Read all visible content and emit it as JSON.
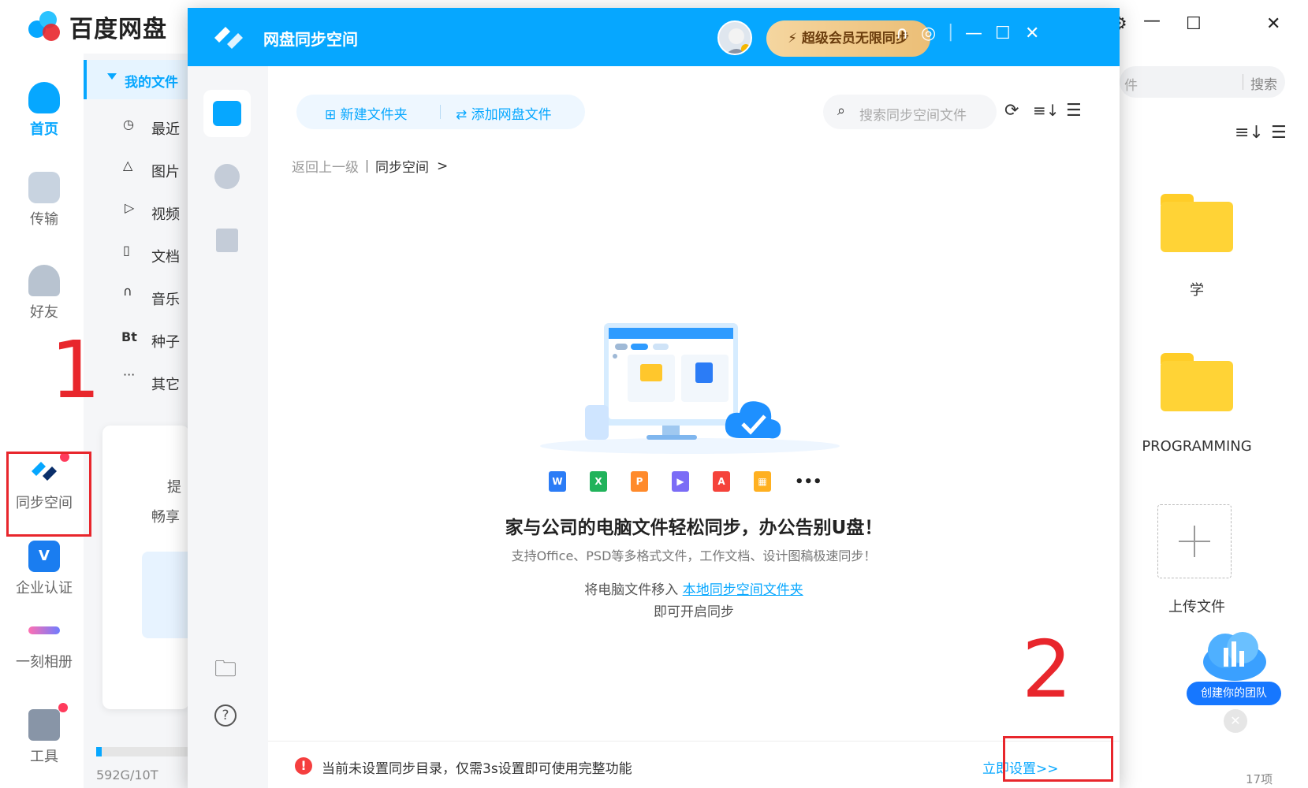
{
  "main_app": {
    "logo_text": "百度网盘",
    "rail": [
      {
        "label": "首页",
        "icon": "cloud-icon"
      },
      {
        "label": "传输",
        "icon": "transfer-icon"
      },
      {
        "label": "好友",
        "icon": "friends-icon"
      },
      {
        "label": "同步空间",
        "icon": "sync-space-icon"
      },
      {
        "label": "企业认证",
        "icon": "enterprise-icon"
      },
      {
        "label": "一刻相册",
        "icon": "album-icon"
      },
      {
        "label": "工具",
        "icon": "tools-icon"
      }
    ],
    "nav": {
      "my_files": "我的文件",
      "items": [
        "最近",
        "图片",
        "视频",
        "文档",
        "音乐",
        "种子",
        "其它"
      ],
      "bt_glyph": "Bt"
    },
    "promo": {
      "line1": "提",
      "line2": "畅享"
    },
    "storage": {
      "text": "592G/10T",
      "used_fraction": 0.058
    },
    "right": {
      "search_placeholder": "件",
      "search_button": "搜索",
      "folders": [
        "学",
        "PROGRAMMING"
      ],
      "upload_label": "上传文件",
      "team_badge": "创建你的团队",
      "count": "17项"
    }
  },
  "annotations": {
    "step1": "1",
    "step2": "2"
  },
  "sync_window": {
    "title": "网盘同步空间",
    "vip_button": "超级会员无限同步",
    "actions": {
      "new_folder": "新建文件夹",
      "add_files": "添加网盘文件"
    },
    "search_placeholder": "搜索同步空间文件",
    "breadcrumb": {
      "back": "返回上一级",
      "current": "同步空间",
      "arrow": ">"
    },
    "file_types": [
      {
        "glyph": "W",
        "color": "#2b7cf6"
      },
      {
        "glyph": "X",
        "color": "#21b35b"
      },
      {
        "glyph": "P",
        "color": "#ff8a2b"
      },
      {
        "glyph": "▶",
        "color": "#7b6cf6"
      },
      {
        "glyph": "A",
        "color": "#f5433b"
      },
      {
        "glyph": "▦",
        "color": "#ffb020"
      }
    ],
    "more_glyph": "•••",
    "empty": {
      "title": "家与公司的电脑文件轻松同步，办公告别U盘！",
      "subtitle": "支持Office、PSD等多格式文件，工作文档、设计图稿极速同步！",
      "line3_prefix": "将电脑文件移入 ",
      "line3_link": "本地同步空间文件夹",
      "line4": "即可开启同步"
    },
    "bottom": {
      "warning": "当前未设置同步目录，仅需3s设置即可使用完整功能",
      "setup_link": "立即设置>>"
    }
  }
}
